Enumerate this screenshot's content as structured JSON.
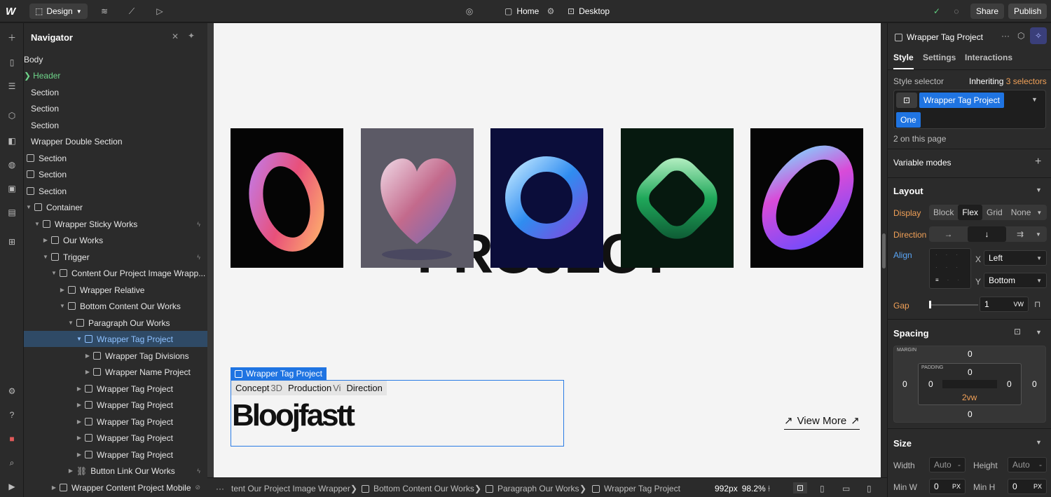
{
  "topbar": {
    "logo": "W",
    "mode_label": "Design",
    "page_name": "Home",
    "breakpoint": "Desktop",
    "share_label": "Share",
    "publish_label": "Publish"
  },
  "navigator": {
    "title": "Navigator",
    "items": [
      {
        "label": "Body"
      },
      {
        "label": "Header"
      },
      {
        "label": "Section"
      },
      {
        "label": "Section"
      },
      {
        "label": "Section"
      },
      {
        "label": "Wrapper Double Section"
      },
      {
        "label": "Section"
      },
      {
        "label": "Section"
      },
      {
        "label": "Section"
      },
      {
        "label": "Container"
      },
      {
        "label": "Wrapper Sticky Works"
      },
      {
        "label": "Our  Works"
      },
      {
        "label": "Trigger"
      },
      {
        "label": "Content Our Project Image Wrapp..."
      },
      {
        "label": "Wrapper Relative"
      },
      {
        "label": "Bottom Content Our Works"
      },
      {
        "label": "Paragraph Our Works"
      },
      {
        "label": "Wrapper Tag Project"
      },
      {
        "label": "Wrapper Tag Divisions"
      },
      {
        "label": "Wrapper Name Project"
      },
      {
        "label": "Wrapper Tag Project"
      },
      {
        "label": "Wrapper Tag Project"
      },
      {
        "label": "Wrapper Tag Project"
      },
      {
        "label": "Wrapper Tag Project"
      },
      {
        "label": "Wrapper Tag Project"
      },
      {
        "label": "Button Link Our Works"
      },
      {
        "label": "Wrapper Content Project Mobile"
      }
    ]
  },
  "canvas": {
    "big_text": "PROJECT",
    "selected_label": "Wrapper Tag Project",
    "tags": [
      "Concept",
      "3D",
      "Production",
      "Vi",
      "Direction"
    ],
    "paragraph_text": "Bloojfastt",
    "view_more": "View More"
  },
  "bottombar": {
    "crumbs": [
      "tent Our Project Image Wrapper",
      "Bottom Content Our Works",
      "Paragraph Our Works",
      "Wrapper Tag Project"
    ],
    "size": "992px",
    "zoom": "98.2%"
  },
  "right": {
    "element_name": "Wrapper Tag Project",
    "tabs": [
      "Style",
      "Settings",
      "Interactions"
    ],
    "style_selector_label": "Style selector",
    "inheriting_label": "Inheriting",
    "inheriting_count": "3 selectors",
    "class_chip": "Wrapper Tag Project",
    "combo_chip": "One",
    "on_page": "2 on this page",
    "variable_modes": "Variable modes",
    "layout_title": "Layout",
    "display_label": "Display",
    "display_options": [
      "Block",
      "Flex",
      "Grid",
      "None"
    ],
    "direction_label": "Direction",
    "align_label": "Align",
    "x_label": "X",
    "x_value": "Left",
    "y_label": "Y",
    "y_value": "Bottom",
    "gap_label": "Gap",
    "gap_value": "1",
    "gap_unit": "VW",
    "spacing_title": "Spacing",
    "margin_label": "MARGIN",
    "padding_label": "PADDING",
    "margin_top": "0",
    "margin_left": "0",
    "margin_right": "0",
    "margin_bottom": "0",
    "padding_top": "0",
    "padding_left": "0",
    "padding_right": "0",
    "padding_bottom": "2vw",
    "size_title": "Size",
    "width_label": "Width",
    "width_value": "Auto",
    "height_label": "Height",
    "height_value": "Auto",
    "minw_label": "Min W",
    "minw_value": "0",
    "minh_label": "Min H",
    "minh_value": "0",
    "px": "PX",
    "dash": "-"
  },
  "colors": {
    "accent": "#1f74e2",
    "selection_row": "#2f4a66",
    "orange": "#f0a057"
  }
}
